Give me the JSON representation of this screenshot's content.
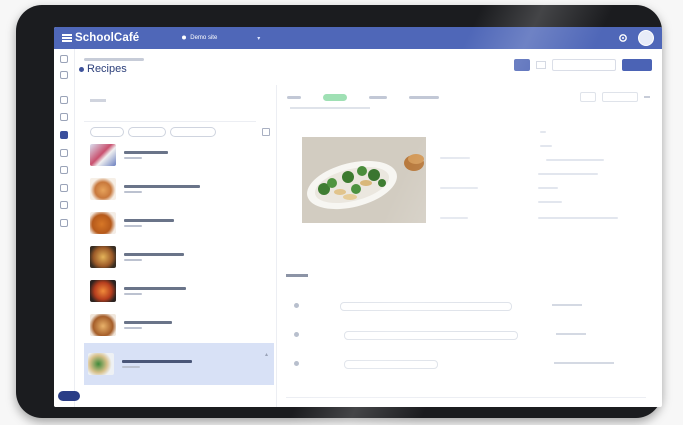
{
  "app": {
    "name": "SchoolCafé",
    "location": "Demo site"
  },
  "page": {
    "title": "Recipes"
  },
  "colors": {
    "header": "#4f67b8",
    "accent": "#4b63b5",
    "selected_row": "#d8e1f6",
    "active_tab": "#9fe0b4"
  },
  "icons": {
    "logo": "schoolcafe-logo-icon",
    "location": "location-pin-icon",
    "settings": "gear-icon",
    "help": "help-button"
  }
}
